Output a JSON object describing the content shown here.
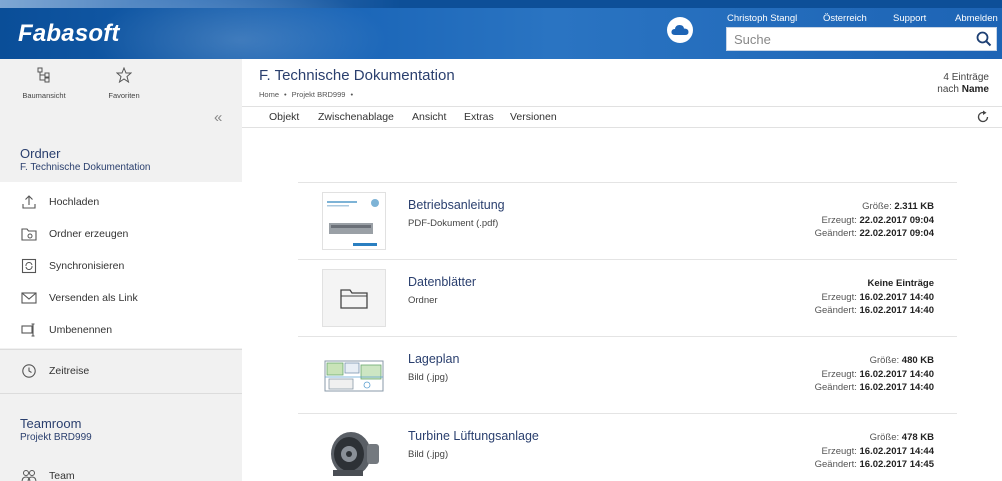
{
  "header": {
    "logo": "Fabasoft",
    "user": "Christoph Stangl",
    "region": "Österreich",
    "support": "Support",
    "logout": "Abmelden",
    "search_placeholder": "Suche",
    "brand_color": "#1d64b5"
  },
  "sidebar": {
    "tools": [
      {
        "label": "Baumansicht",
        "icon": "tree-view-icon"
      },
      {
        "label": "Favoriten",
        "icon": "star-icon"
      }
    ],
    "collapse_icon": "double-chevron-left-icon",
    "folder": {
      "title": "Ordner",
      "name": "F. Technische Dokumentation"
    },
    "actions": [
      {
        "label": "Hochladen",
        "icon": "upload-icon"
      },
      {
        "label": "Ordner erzeugen",
        "icon": "create-folder-icon"
      },
      {
        "label": "Synchronisieren",
        "icon": "sync-icon"
      },
      {
        "label": "Versenden als Link",
        "icon": "envelope-icon"
      },
      {
        "label": "Umbenennen",
        "icon": "rename-icon"
      }
    ],
    "timetravel": {
      "label": "Zeitreise",
      "icon": "clock-icon"
    },
    "teamroom": {
      "title": "Teamroom",
      "name": "Projekt BRD999"
    },
    "team": {
      "label": "Team",
      "icon": "team-icon"
    }
  },
  "main": {
    "title": "F. Technische Dokumentation",
    "breadcrumb": [
      "Home",
      "Projekt BRD999"
    ],
    "count_line1": "4 Einträge",
    "count_prefix": "nach",
    "count_sort": "Name",
    "menu": [
      "Objekt",
      "Zwischenablage",
      "Ansicht",
      "Extras",
      "Versionen"
    ]
  },
  "items": [
    {
      "name": "Betriebsanleitung",
      "type": "PDF-Dokument (.pdf)",
      "size_label": "Größe:",
      "size": "2.311 KB",
      "created_label": "Erzeugt:",
      "created": "22.02.2017 09:04",
      "modified_label": "Geändert:",
      "modified": "22.02.2017 09:04"
    },
    {
      "name": "Datenblätter",
      "type": "Ordner",
      "size_label": "Keine Einträge",
      "size": "",
      "created_label": "Erzeugt:",
      "created": "16.02.2017 14:40",
      "modified_label": "Geändert:",
      "modified": "16.02.2017 14:40"
    },
    {
      "name": "Lageplan",
      "type": "Bild (.jpg)",
      "size_label": "Größe:",
      "size": "480 KB",
      "created_label": "Erzeugt:",
      "created": "16.02.2017 14:40",
      "modified_label": "Geändert:",
      "modified": "16.02.2017 14:40"
    },
    {
      "name": "Turbine Lüftungsanlage",
      "type": "Bild (.jpg)",
      "size_label": "Größe:",
      "size": "478 KB",
      "created_label": "Erzeugt:",
      "created": "16.02.2017 14:44",
      "modified_label": "Geändert:",
      "modified": "16.02.2017 14:45"
    }
  ]
}
